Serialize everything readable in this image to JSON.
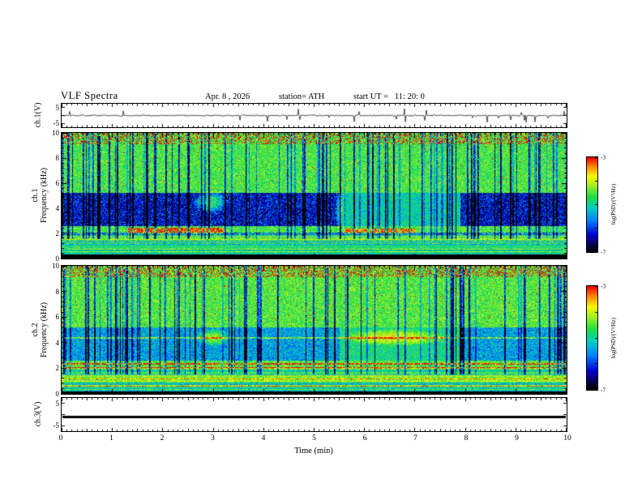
{
  "header": {
    "title": "VLF Spectra",
    "date": "Apr. 8 , 2026",
    "station": "station= ATH",
    "start_ut": "start UT =   11: 20: 0"
  },
  "xaxis": {
    "label": "Time (min)",
    "ticks": [
      "0",
      "1",
      "2",
      "3",
      "4",
      "5",
      "6",
      "7",
      "8",
      "9",
      "10"
    ],
    "xlim": [
      0,
      10
    ]
  },
  "panels": {
    "ch1_wave": {
      "ylabel": "ch.1(V)",
      "ytick_top": "5",
      "ytick_bottom": "-5",
      "ylim": [
        -5,
        5
      ]
    },
    "ch1_spec": {
      "ylabel_line1": "ch.1",
      "ylabel_line2": "Frequency (kHz)",
      "yticks": [
        "10",
        "8",
        "6",
        "4",
        "2",
        "0"
      ],
      "ylim": [
        0,
        10
      ]
    },
    "ch2_spec": {
      "ylabel_line1": "ch.2",
      "ylabel_line2": "Frequency (kHz)",
      "yticks": [
        "10",
        "8",
        "6",
        "4",
        "2",
        "0"
      ],
      "ylim": [
        0,
        10
      ]
    },
    "ch3_wave": {
      "ylabel": "ch.3(V)",
      "ytick_top": "5",
      "ytick_bottom": "-5",
      "ylim": [
        -5,
        5
      ]
    }
  },
  "colorbars": [
    {
      "label": "log(PSD)/(V²/Hz)",
      "tick_top": "-3",
      "tick_bottom": "-7",
      "range": [
        -7,
        -3
      ]
    },
    {
      "label": "log(PSD)/(V²/Hz)",
      "tick_top": "-3",
      "tick_bottom": "-7",
      "range": [
        -7,
        -3
      ]
    }
  ],
  "colors": {
    "frame": "#000000",
    "background": "#ffffff",
    "colormap": [
      [
        0.0,
        0,
        0,
        0
      ],
      [
        0.06,
        5,
        5,
        60
      ],
      [
        0.18,
        0,
        0,
        210
      ],
      [
        0.33,
        0,
        130,
        255
      ],
      [
        0.47,
        0,
        210,
        190
      ],
      [
        0.58,
        30,
        220,
        70
      ],
      [
        0.7,
        160,
        240,
        40
      ],
      [
        0.8,
        250,
        250,
        0
      ],
      [
        0.9,
        255,
        140,
        0
      ],
      [
        1.0,
        235,
        0,
        0
      ]
    ]
  },
  "chart_data": [
    {
      "type": "line",
      "title": "ch.1(V) time series",
      "xlabel": "Time (min)",
      "ylabel": "ch.1(V)",
      "xlim": [
        0,
        10
      ],
      "ylim": [
        -5,
        5
      ],
      "description": "Noisy waveform centered near 0 V (about ±0.5 V) with dense impulsive spikes reaching roughly ±4 V throughout the 10-minute record."
    },
    {
      "type": "heatmap",
      "title": "ch.1 VLF spectrogram",
      "xlabel": "Time (min)",
      "ylabel": "Frequency (kHz)",
      "xlim": [
        0,
        10
      ],
      "ylim": [
        0,
        10
      ],
      "zlabel": "log(PSD)/(V²/Hz)",
      "zlim": [
        -7,
        -3
      ],
      "legend_position": "right colorbar",
      "features": [
        "broadband green background near -4.5",
        "dense vertical blue impulsive streaks (sferics) spanning all frequencies",
        "dark blue quiet band about 2.5-5 kHz, strongest 0-5.5 min and 8-10 min, lighter cyan-green 5.5-8 min",
        "orange/red enhancement near 2-2.5 kHz around 1.5-3 min and 5.5-7 min",
        "cyan-green patch near 4-5 kHz around 3 min",
        "red/orange speckle near 9-10 kHz",
        "solid black band below about 0.3 kHz (value -7)"
      ]
    },
    {
      "type": "heatmap",
      "title": "ch.2 VLF spectrogram",
      "xlabel": "Time (min)",
      "ylabel": "Frequency (kHz)",
      "xlim": [
        0,
        10
      ],
      "ylim": [
        0,
        10
      ],
      "zlabel": "log(PSD)/(V²/Hz)",
      "zlim": [
        -7,
        -3
      ],
      "legend_position": "right colorbar",
      "features": [
        "broadband green background near -4.5",
        "dense vertical blue impulsive streaks spanning all frequencies",
        "weaker blue band 2.5-5 kHz in first half, mostly green after 5.5 min",
        "thin orange horizontal lines near 2.0, 2.35 and 4.35 kHz across the whole record",
        "bright yellow-green patches near 4-5 kHz around 3 min and 5.5-7.5 min",
        "red/orange speckle near 9-10 kHz",
        "thin black band at the lowest frequencies"
      ]
    },
    {
      "type": "line",
      "title": "ch.3(V) time series",
      "xlabel": "Time (min)",
      "ylabel": "ch.3(V)",
      "xlim": [
        0,
        10
      ],
      "ylim": [
        -5,
        5
      ],
      "constant_value": -0.5,
      "description": "Flat thick black trace, constant near 0 to -0.5 V for the whole record (no signal)."
    }
  ]
}
